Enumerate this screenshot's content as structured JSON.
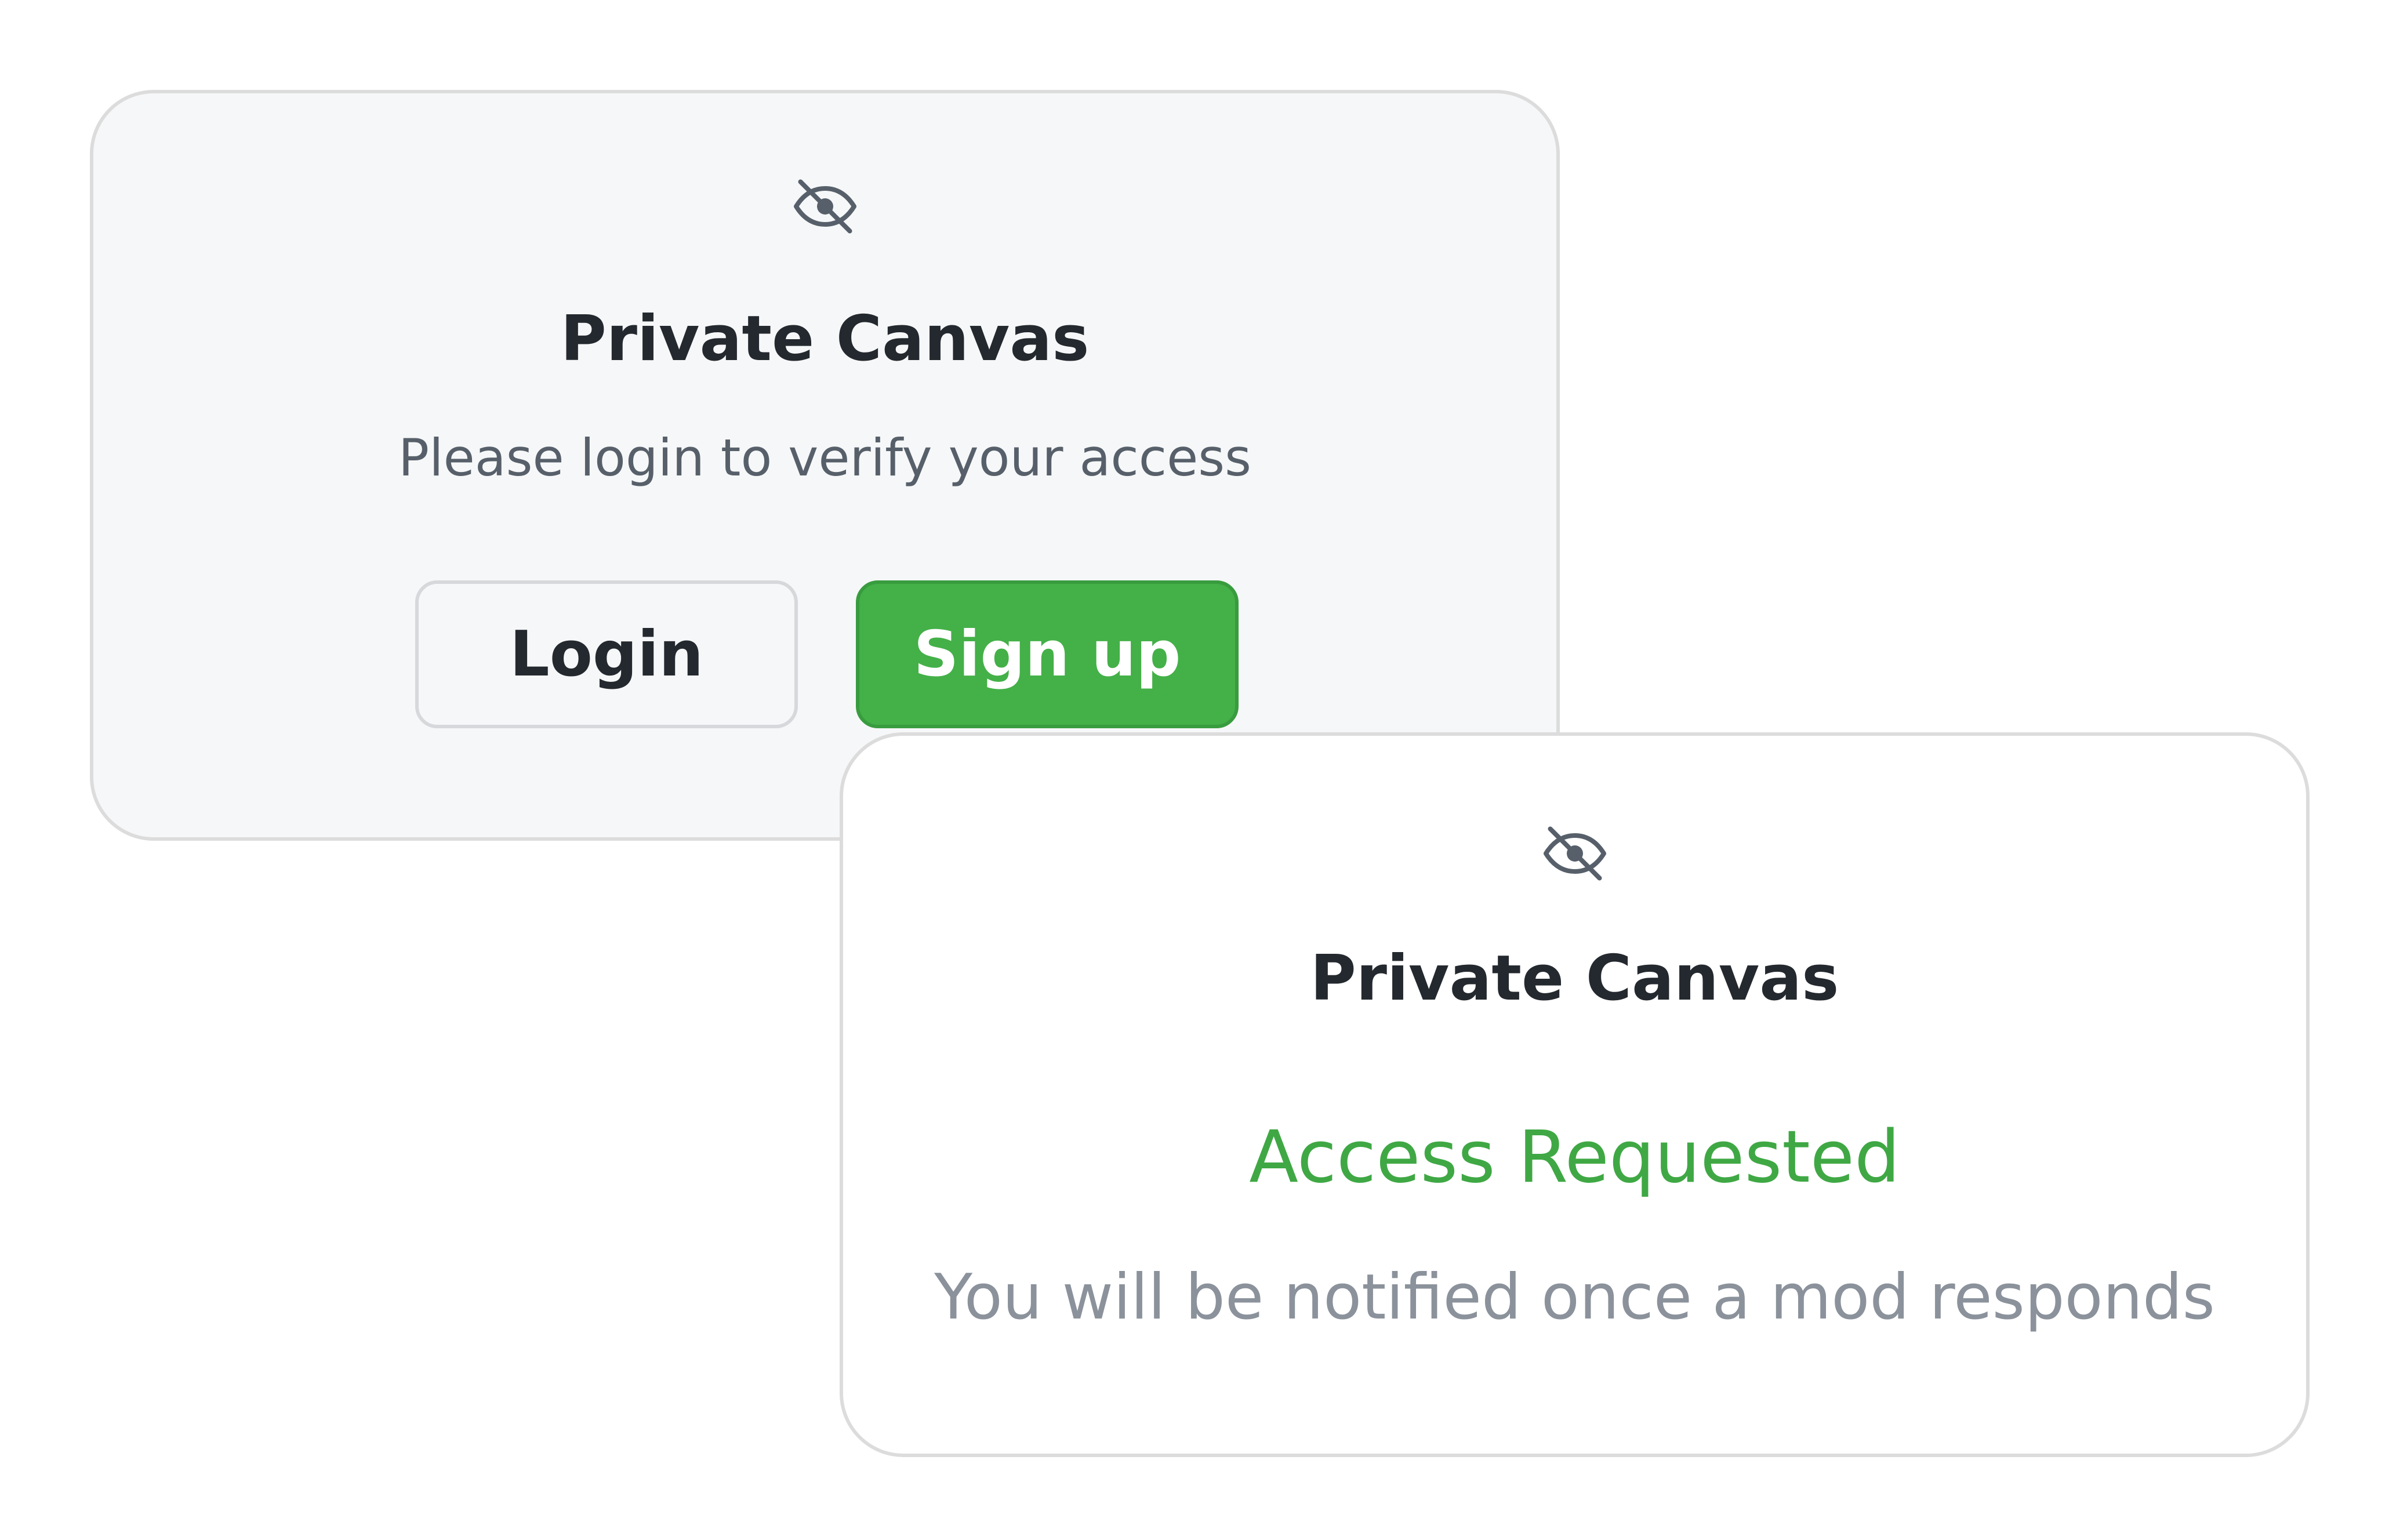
{
  "login_card": {
    "icon": "eye-off-icon",
    "title": "Private Canvas",
    "subtitle": "Please login to verify your access",
    "login_label": "Login",
    "signup_label": "Sign up"
  },
  "requested_card": {
    "icon": "eye-off-icon",
    "title": "Private Canvas",
    "status": "Access Requested",
    "note": "You will be notified once a mod responds"
  },
  "colors": {
    "accent_green": "#44b048",
    "status_green": "#3fa844",
    "text_dark": "#24292f",
    "text_muted": "#57606a",
    "text_light": "#8b929b",
    "card_bg": "#f6f7f8",
    "border": "#dcdcdc"
  }
}
